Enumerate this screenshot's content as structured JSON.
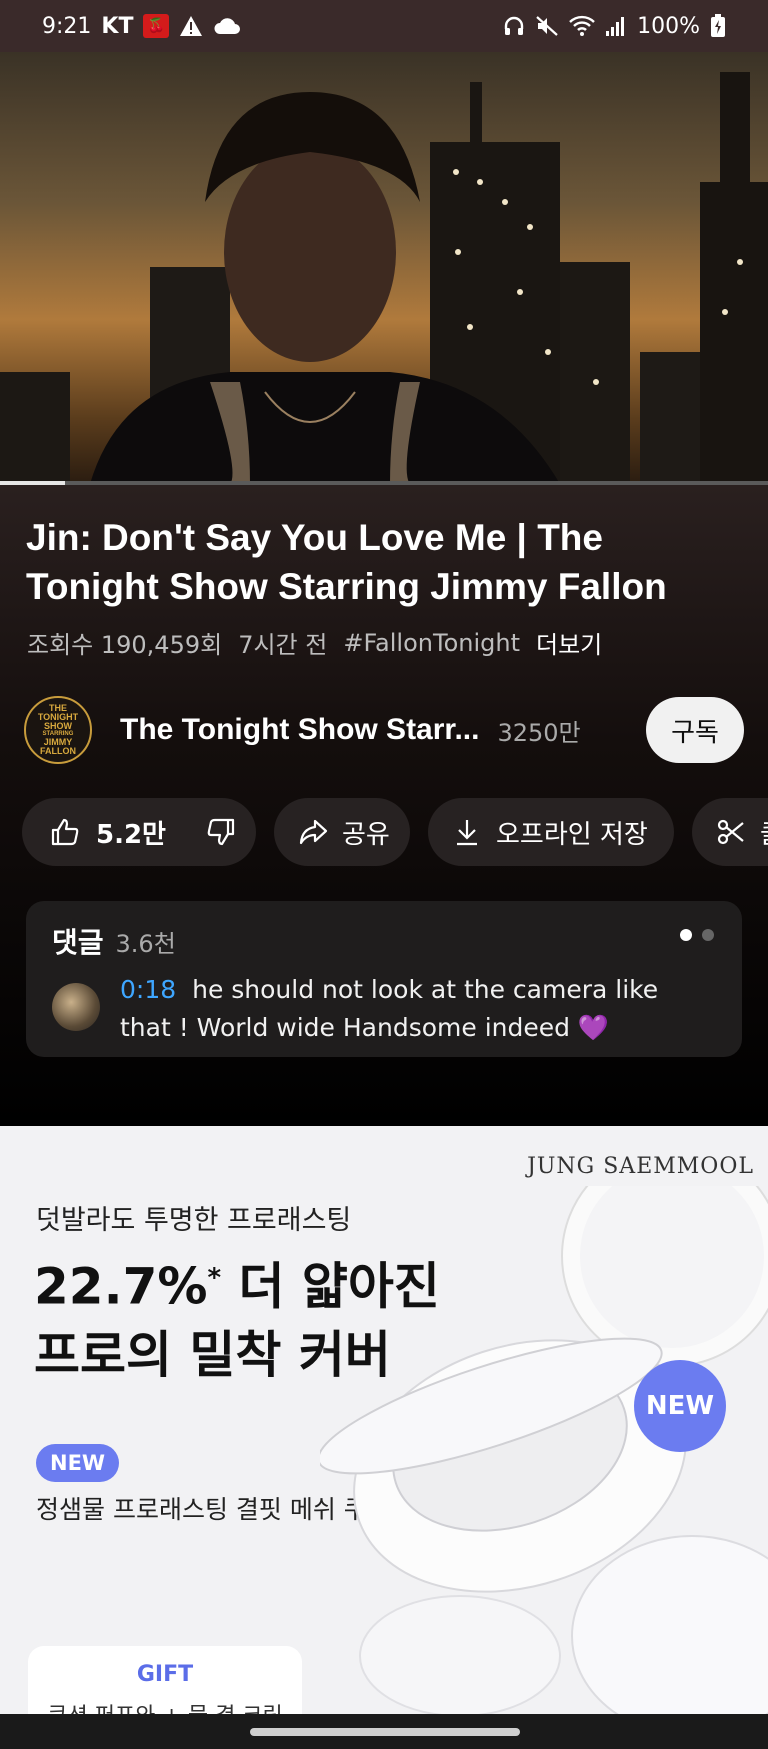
{
  "status_bar": {
    "time": "9:21",
    "carrier": "KT",
    "battery": "100%",
    "icons": [
      "carrier-app-icon",
      "alert-icon",
      "cloud-icon",
      "headphones-icon",
      "mute-icon",
      "wifi-icon",
      "signal-icon",
      "battery-charging-icon"
    ]
  },
  "video": {
    "progress_fraction": 0.085
  },
  "info": {
    "title": "Jin: Don't Say You Love Me | The Tonight Show Starring Jimmy Fallon",
    "views": "조회수 190,459회",
    "age": "7시간 전",
    "hashtag": "#FallonTonight",
    "more": "더보기"
  },
  "channel": {
    "logo_text": [
      "THE",
      "TONIGHT",
      "SHOW",
      "STARRING",
      "JIMMY",
      "FALLON"
    ],
    "name": "The Tonight Show Starr...",
    "subscribers": "3250만",
    "subscribe_label": "구독"
  },
  "actions": {
    "like_count": "5.2만",
    "share_label": "공유",
    "save_label": "오프라인 저장",
    "clip_label": "클"
  },
  "comments": {
    "label": "댓글",
    "count": "3.6천",
    "timestamp": "0:18",
    "text": "he should not look at the camera like that ! World wide Handsome indeed 💜"
  },
  "ad": {
    "brand": "JUNG SAEMMOOL",
    "subheading": "덧발라도 투명한 프로래스팅",
    "headline_1": "22.7%",
    "headline_mark": "*",
    "headline_1b": " 더 얇아진",
    "headline_2": "프로의 밀착 커버",
    "new_pill": "NEW",
    "product_name": "정샘물 프로래스팅 결핏 메쉬 쿠션",
    "gift_label": "GIFT",
    "gift_line": "쿠션 퍼프와 + 물 결 크림",
    "badge_new": "NEW",
    "badge_color": "#6b7cf0"
  }
}
